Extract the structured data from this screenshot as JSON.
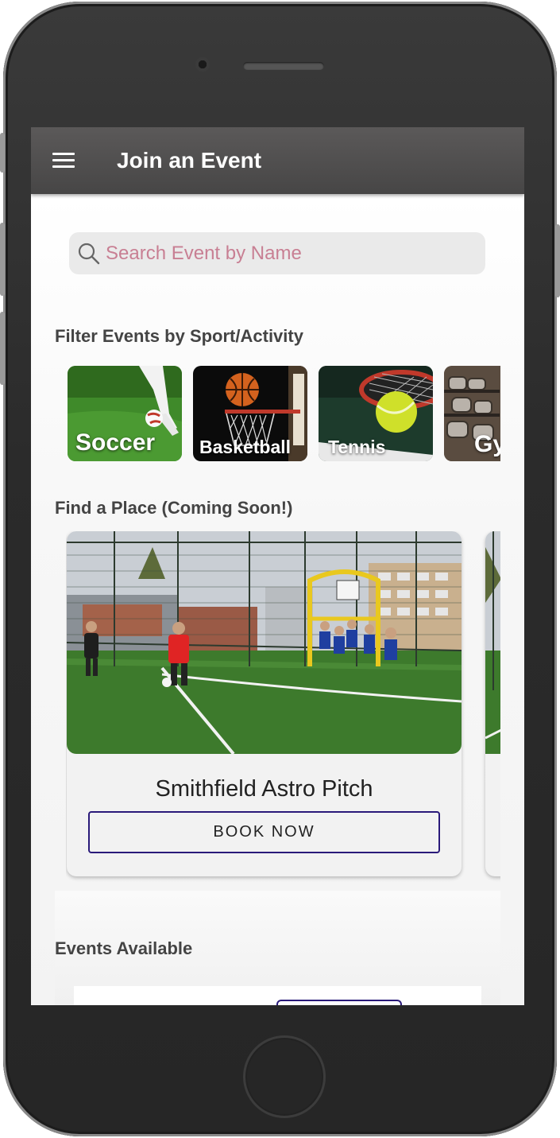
{
  "appbar": {
    "title": "Join an Event",
    "menu_icon": "hamburger-menu-icon"
  },
  "search": {
    "placeholder": "Search Event by Name",
    "icon": "search-icon",
    "placeholder_color": "#c87f93"
  },
  "filter_section": {
    "title": "Filter Events by Sport/Activity",
    "sports": [
      {
        "label": "Soccer"
      },
      {
        "label": "Basketball"
      },
      {
        "label": "Tennis"
      },
      {
        "label": "Gy"
      }
    ]
  },
  "places_section": {
    "title": "Find a Place (Coming Soon!)",
    "places": [
      {
        "name": "Smithfield Astro Pitch",
        "button_label": "BOOK NOW"
      }
    ]
  },
  "events_section": {
    "title": "Events Available"
  },
  "colors": {
    "appbar": "#4f4e4e",
    "accent_border": "#2a1a7a",
    "phone_body": "#2b2b2b"
  }
}
